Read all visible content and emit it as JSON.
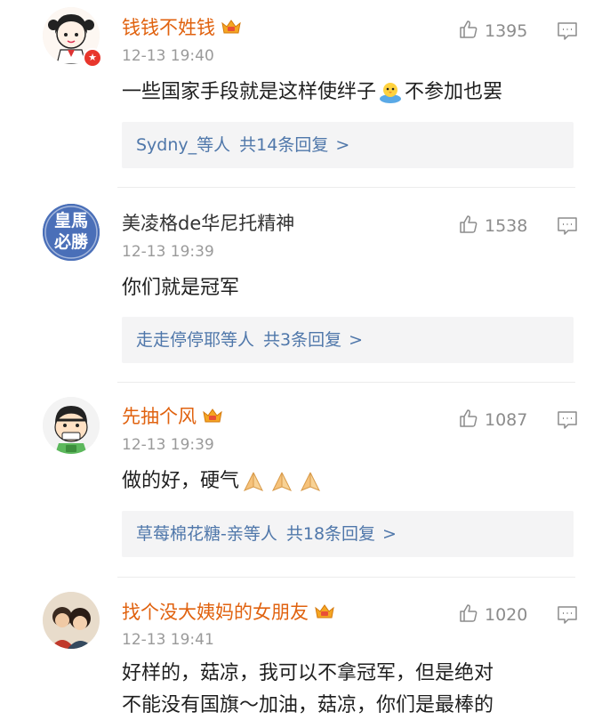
{
  "colors": {
    "vip_name": "#e0620f",
    "reply_link": "#4f77aa",
    "meta_gray": "#9a9a9a",
    "reply_bg": "#f4f4f5"
  },
  "comments": [
    {
      "username": "钱钱不姓钱",
      "timestamp": "12-13 19:40",
      "likes": "1395",
      "text_before_emoji": "一些国家手段就是这样使绊子",
      "emoji": "chicken-emoji",
      "text_after_emoji": "不参加也罢",
      "reply_names": "Sydny_等人",
      "reply_count": "共14条回复",
      "reply_chevron": ">",
      "badge_icon": "verified-badge-icon",
      "vip_icon": "crown-vip-icon"
    },
    {
      "username": "美凌格de华尼托精神",
      "timestamp": "12-13 19:39",
      "likes": "1538",
      "text": "你们就是冠军",
      "reply_names": "走走停停耶等人",
      "reply_count": "共3条回复",
      "reply_chevron": ">",
      "avatar_text_top": "皇馬",
      "avatar_text_bottom": "必勝"
    },
    {
      "username": "先抽个风",
      "timestamp": "12-13 19:39",
      "likes": "1087",
      "text": "做的好，硬气",
      "emoji": "pray-hands-emoji",
      "emoji_count": 3,
      "reply_names": "草莓棉花糖-亲等人",
      "reply_count": "共18条回复",
      "reply_chevron": ">",
      "vip_icon": "crown-vip-icon"
    },
    {
      "username": "找个没大姨妈的女朋友",
      "timestamp": "12-13 19:41",
      "likes": "1020",
      "text_line1": "好样的，菇凉，我可以不拿冠军，但是绝对",
      "text_line2": "不能没有国旗～加油，菇凉，你们是最棒的",
      "vip_icon": "crown-vip-icon"
    }
  ]
}
